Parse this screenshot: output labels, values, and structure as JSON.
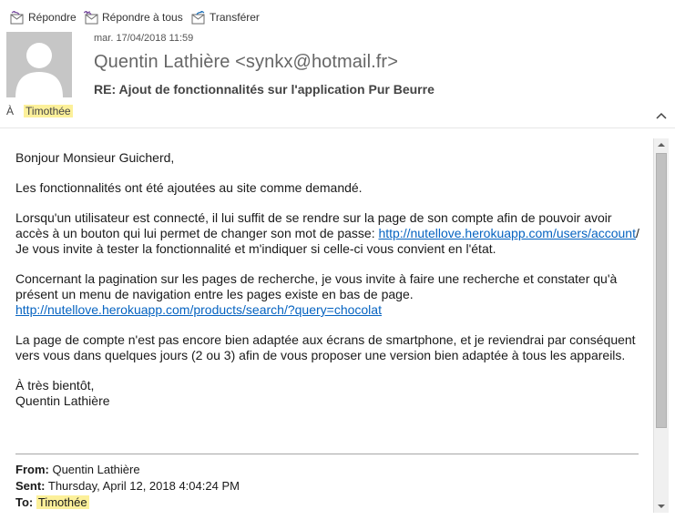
{
  "toolbar": {
    "reply_label": "Répondre",
    "reply_all_label": "Répondre à tous",
    "forward_label": "Transférer"
  },
  "header": {
    "date": "mar. 17/04/2018 11:59",
    "sender": "Quentin Lathière <synkx@hotmail.fr>",
    "subject": "RE: Ajout de fonctionnalités sur l'application Pur Beurre",
    "to_label": "À",
    "to_value": "Timothée"
  },
  "body": {
    "greeting": "Bonjour Monsieur Guicherd,",
    "p1": "Les fonctionnalités ont été ajoutées au site comme demandé.",
    "p2_text": "Lorsqu'un utilisateur est connecté, il lui suffit de se rendre sur la page de son compte afin de pouvoir avoir accès à un bouton qui lui permet de changer son mot de passe: ",
    "p2_link": "http://nutellove.herokuapp.com/users/account",
    "p2_after_link": "/",
    "p2_line2": "Je vous invite à tester la fonctionnalité et m'indiquer si celle-ci vous convient en l'état.",
    "p3_text": "Concernant la pagination sur les pages de recherche, je vous invite à faire une recherche et constater qu'à présent un menu de navigation entre les pages existe en bas de page.",
    "p3_link": "http://nutellove.herokuapp.com/products/search/?query=chocolat",
    "p4": "La page de compte n'est pas encore bien adaptée aux écrans de smartphone, et je reviendrai par conséquent vers vous dans quelques jours (2 ou 3) afin de vous proposer une version bien adaptée à tous les appareils.",
    "closing": "À très bientôt,",
    "signature": "Quentin Lathière"
  },
  "forwarded": {
    "from_label": "From:",
    "from_value": "Quentin Lathière",
    "sent_label": "Sent:",
    "sent_value": "Thursday, April 12, 2018 4:04:24 PM",
    "to_label": "To:",
    "to_value": "Timothée"
  },
  "colors": {
    "link": "#0563c1",
    "highlight": "#fcf09a",
    "avatar_bg": "#c6c6c6"
  },
  "icons": [
    "reply-icon",
    "reply-all-icon",
    "forward-icon",
    "person-icon",
    "chevron-up-icon",
    "scroll-up-icon",
    "scroll-down-icon"
  ]
}
